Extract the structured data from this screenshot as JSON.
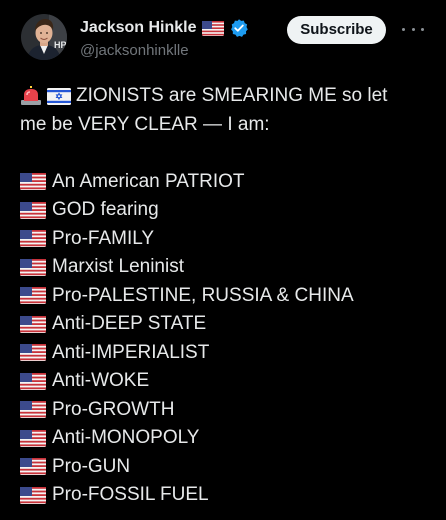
{
  "author": {
    "display_name": "Jackson Hinkle",
    "handle": "@jacksonhinklle",
    "name_flag_icon": "us-flag-icon",
    "verified_icon": "verified-badge-icon",
    "verified_color": "#1d9bf0"
  },
  "actions": {
    "subscribe_label": "Subscribe",
    "more_icon": "more-options-icon"
  },
  "post": {
    "intro_icons": [
      "siren-icon",
      "israel-flag-icon"
    ],
    "intro_line1": "ZIONISTS are SMEARING ME so let",
    "intro_line2": "me be VERY CLEAR — I am:",
    "list_icon": "us-flag-icon",
    "items": [
      "An American PATRIOT",
      "GOD fearing",
      "Pro-FAMILY",
      "Marxist Leninist",
      "Pro-PALESTINE, RUSSIA & CHINA",
      "Anti-DEEP STATE",
      "Anti-IMPERIALIST",
      "Anti-WOKE",
      "Pro-GROWTH",
      "Anti-MONOPOLY",
      "Pro-GUN",
      "Pro-FOSSIL FUEL"
    ]
  },
  "colors": {
    "background": "#000000",
    "text": "#e7e9ea",
    "secondary_text": "#71767b",
    "button_bg": "#eff3f4",
    "button_text": "#0f1419"
  }
}
